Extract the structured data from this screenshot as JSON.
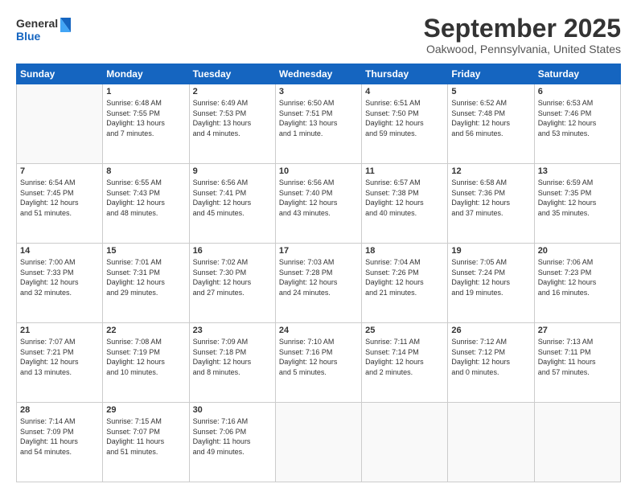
{
  "header": {
    "logo_general": "General",
    "logo_blue": "Blue",
    "month_title": "September 2025",
    "location": "Oakwood, Pennsylvania, United States"
  },
  "weekdays": [
    "Sunday",
    "Monday",
    "Tuesday",
    "Wednesday",
    "Thursday",
    "Friday",
    "Saturday"
  ],
  "weeks": [
    [
      {
        "day": "",
        "info": ""
      },
      {
        "day": "1",
        "info": "Sunrise: 6:48 AM\nSunset: 7:55 PM\nDaylight: 13 hours\nand 7 minutes."
      },
      {
        "day": "2",
        "info": "Sunrise: 6:49 AM\nSunset: 7:53 PM\nDaylight: 13 hours\nand 4 minutes."
      },
      {
        "day": "3",
        "info": "Sunrise: 6:50 AM\nSunset: 7:51 PM\nDaylight: 13 hours\nand 1 minute."
      },
      {
        "day": "4",
        "info": "Sunrise: 6:51 AM\nSunset: 7:50 PM\nDaylight: 12 hours\nand 59 minutes."
      },
      {
        "day": "5",
        "info": "Sunrise: 6:52 AM\nSunset: 7:48 PM\nDaylight: 12 hours\nand 56 minutes."
      },
      {
        "day": "6",
        "info": "Sunrise: 6:53 AM\nSunset: 7:46 PM\nDaylight: 12 hours\nand 53 minutes."
      }
    ],
    [
      {
        "day": "7",
        "info": "Sunrise: 6:54 AM\nSunset: 7:45 PM\nDaylight: 12 hours\nand 51 minutes."
      },
      {
        "day": "8",
        "info": "Sunrise: 6:55 AM\nSunset: 7:43 PM\nDaylight: 12 hours\nand 48 minutes."
      },
      {
        "day": "9",
        "info": "Sunrise: 6:56 AM\nSunset: 7:41 PM\nDaylight: 12 hours\nand 45 minutes."
      },
      {
        "day": "10",
        "info": "Sunrise: 6:56 AM\nSunset: 7:40 PM\nDaylight: 12 hours\nand 43 minutes."
      },
      {
        "day": "11",
        "info": "Sunrise: 6:57 AM\nSunset: 7:38 PM\nDaylight: 12 hours\nand 40 minutes."
      },
      {
        "day": "12",
        "info": "Sunrise: 6:58 AM\nSunset: 7:36 PM\nDaylight: 12 hours\nand 37 minutes."
      },
      {
        "day": "13",
        "info": "Sunrise: 6:59 AM\nSunset: 7:35 PM\nDaylight: 12 hours\nand 35 minutes."
      }
    ],
    [
      {
        "day": "14",
        "info": "Sunrise: 7:00 AM\nSunset: 7:33 PM\nDaylight: 12 hours\nand 32 minutes."
      },
      {
        "day": "15",
        "info": "Sunrise: 7:01 AM\nSunset: 7:31 PM\nDaylight: 12 hours\nand 29 minutes."
      },
      {
        "day": "16",
        "info": "Sunrise: 7:02 AM\nSunset: 7:30 PM\nDaylight: 12 hours\nand 27 minutes."
      },
      {
        "day": "17",
        "info": "Sunrise: 7:03 AM\nSunset: 7:28 PM\nDaylight: 12 hours\nand 24 minutes."
      },
      {
        "day": "18",
        "info": "Sunrise: 7:04 AM\nSunset: 7:26 PM\nDaylight: 12 hours\nand 21 minutes."
      },
      {
        "day": "19",
        "info": "Sunrise: 7:05 AM\nSunset: 7:24 PM\nDaylight: 12 hours\nand 19 minutes."
      },
      {
        "day": "20",
        "info": "Sunrise: 7:06 AM\nSunset: 7:23 PM\nDaylight: 12 hours\nand 16 minutes."
      }
    ],
    [
      {
        "day": "21",
        "info": "Sunrise: 7:07 AM\nSunset: 7:21 PM\nDaylight: 12 hours\nand 13 minutes."
      },
      {
        "day": "22",
        "info": "Sunrise: 7:08 AM\nSunset: 7:19 PM\nDaylight: 12 hours\nand 10 minutes."
      },
      {
        "day": "23",
        "info": "Sunrise: 7:09 AM\nSunset: 7:18 PM\nDaylight: 12 hours\nand 8 minutes."
      },
      {
        "day": "24",
        "info": "Sunrise: 7:10 AM\nSunset: 7:16 PM\nDaylight: 12 hours\nand 5 minutes."
      },
      {
        "day": "25",
        "info": "Sunrise: 7:11 AM\nSunset: 7:14 PM\nDaylight: 12 hours\nand 2 minutes."
      },
      {
        "day": "26",
        "info": "Sunrise: 7:12 AM\nSunset: 7:12 PM\nDaylight: 12 hours\nand 0 minutes."
      },
      {
        "day": "27",
        "info": "Sunrise: 7:13 AM\nSunset: 7:11 PM\nDaylight: 11 hours\nand 57 minutes."
      }
    ],
    [
      {
        "day": "28",
        "info": "Sunrise: 7:14 AM\nSunset: 7:09 PM\nDaylight: 11 hours\nand 54 minutes."
      },
      {
        "day": "29",
        "info": "Sunrise: 7:15 AM\nSunset: 7:07 PM\nDaylight: 11 hours\nand 51 minutes."
      },
      {
        "day": "30",
        "info": "Sunrise: 7:16 AM\nSunset: 7:06 PM\nDaylight: 11 hours\nand 49 minutes."
      },
      {
        "day": "",
        "info": ""
      },
      {
        "day": "",
        "info": ""
      },
      {
        "day": "",
        "info": ""
      },
      {
        "day": "",
        "info": ""
      }
    ]
  ]
}
